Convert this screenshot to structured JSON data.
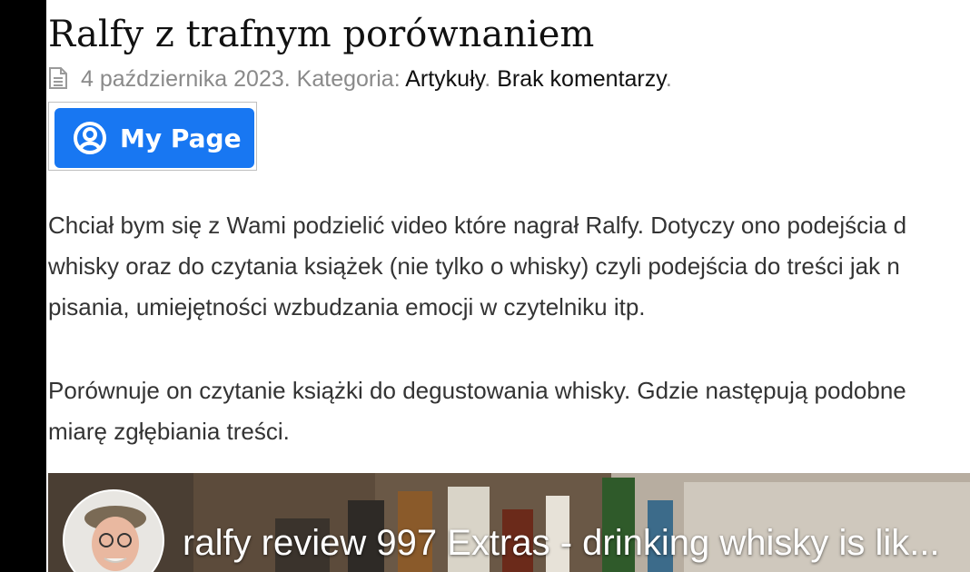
{
  "post": {
    "title": "Ralfy z trafnym porównaniem",
    "date": "4 października 2023.",
    "category_prefix": "Kategoria:",
    "category": "Artykuły",
    "comments": "Brak komentarzy"
  },
  "mypage_button": {
    "label": "My Page",
    "color": "#1877f2"
  },
  "paragraphs": [
    {
      "line1": "Chciał bym się z Wami podzielić video które nagrał Ralfy. Dotyczy ono podejścia d",
      "line2": "whisky oraz do czytania książek (nie tylko o whisky) czyli podejścia do treści jak n",
      "line3": "pisania, umiejętności wzbudzania emocji w czytelniku itp."
    },
    {
      "line1": "Porównuje on czytanie książki do degustowania whisky. Gdzie następują podobne",
      "line2": "miarę zgłębiania treści."
    }
  ],
  "video": {
    "title": "ralfy review 997 Extras - drinking whisky is lik..."
  },
  "icons": {
    "meta": "document-icon",
    "mypage": "user-circle-icon",
    "avatar": "channel-avatar"
  }
}
